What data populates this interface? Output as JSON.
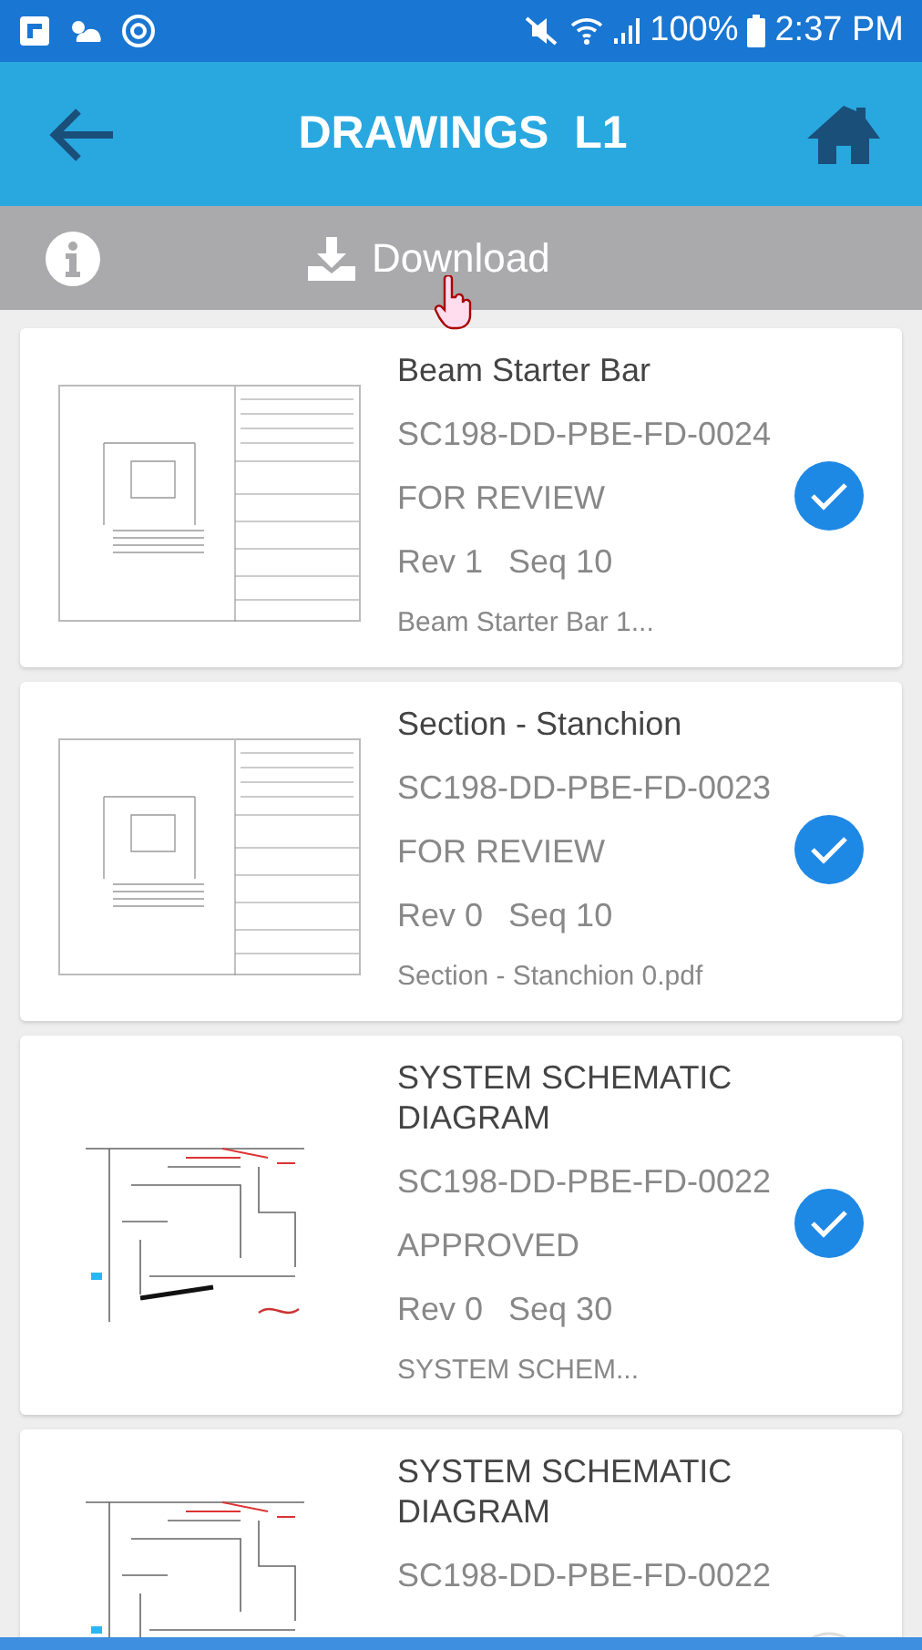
{
  "status_bar": {
    "battery": "100%",
    "time": "2:37 PM"
  },
  "app_bar": {
    "title": "DRAWINGS  L1"
  },
  "toolbar": {
    "download": "Download"
  },
  "drawings": [
    {
      "title": "Beam Starter Bar",
      "code": "SC198-DD-PBE-FD-0024",
      "status": "FOR REVIEW",
      "rev": "Rev 1",
      "seq": "Seq 10",
      "file": "Beam Starter Bar 1...",
      "kind": "sheet",
      "selected": true
    },
    {
      "title": "Section - Stanchion",
      "code": "SC198-DD-PBE-FD-0023",
      "status": "FOR REVIEW",
      "rev": "Rev 0",
      "seq": "Seq 10",
      "file": "Section - Stanchion 0.pdf",
      "kind": "sheet",
      "selected": true
    },
    {
      "title": "SYSTEM SCHEMATIC DIAGRAM",
      "code": "SC198-DD-PBE-FD-0022",
      "status": "APPROVED",
      "rev": "Rev 0",
      "seq": "Seq 30",
      "file": "SYSTEM SCHEM...",
      "kind": "schematic",
      "selected": true
    },
    {
      "title": "SYSTEM SCHEMATIC DIAGRAM",
      "code": "SC198-DD-PBE-FD-0022",
      "kind": "schematic",
      "selected": false
    }
  ]
}
